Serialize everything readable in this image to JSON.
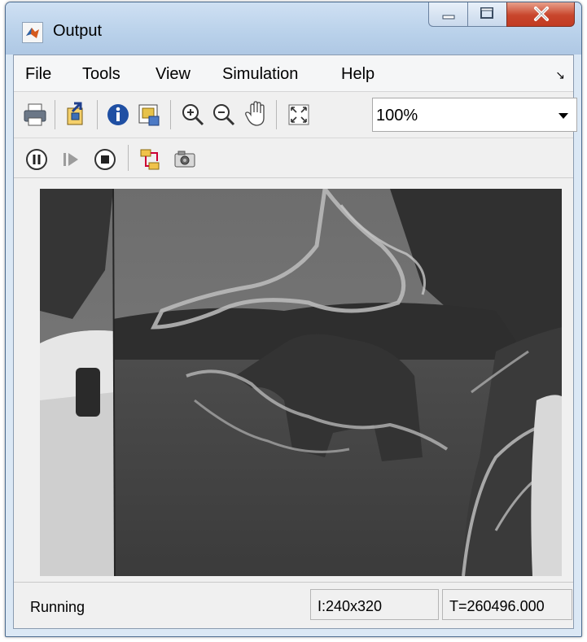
{
  "window": {
    "title": "Output",
    "icon": "matlab-logo-icon",
    "controls": [
      "minimize-icon",
      "maximize-icon",
      "close-icon"
    ]
  },
  "menubar": {
    "items": [
      {
        "label": "File"
      },
      {
        "label": "Tools"
      },
      {
        "label": "View"
      },
      {
        "label": "Simulation"
      },
      {
        "label": "Help"
      }
    ],
    "dock_icon": "undock-arrow-icon"
  },
  "toolbar": {
    "buttons": [
      "print-icon",
      "highlight-model-icon",
      "info-icon",
      "maintain-fit-icon",
      "zoom-in-icon",
      "zoom-out-icon",
      "pan-hand-icon",
      "fit-to-view-icon"
    ],
    "zoom": {
      "value": "100%"
    }
  },
  "sim_toolbar": {
    "buttons": [
      "pause-icon",
      "step-forward-icon",
      "stop-icon",
      "signal-flow-icon",
      "snapshot-camera-icon"
    ]
  },
  "viewer": {
    "content": "rhino-road-scene-with-edge-overlay"
  },
  "status": {
    "state": "Running",
    "dimensions": "I:240x320",
    "time": "T=260496.000"
  }
}
